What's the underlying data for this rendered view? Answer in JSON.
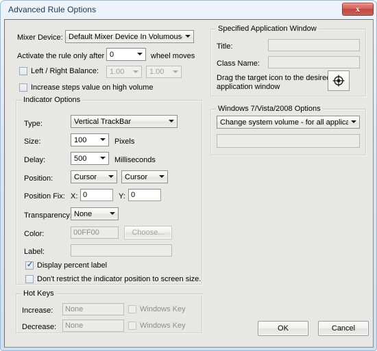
{
  "window": {
    "title": "Advanced Rule Options",
    "close_label": "x",
    "close_icon": "close-icon"
  },
  "mixer": {
    "label": "Mixer Device:",
    "value": "Default Mixer Device In Volumouse"
  },
  "activate": {
    "label": "Activate the rule only after",
    "value": "0",
    "suffix": "wheel moves"
  },
  "balance": {
    "checkbox_label": "Left / Right Balance:",
    "checked": false,
    "left_value": "1.00",
    "right_value": "1.00"
  },
  "increase_steps": {
    "label": "Increase steps value on high volume",
    "checked": false
  },
  "indicator": {
    "group_title": "Indicator Options",
    "type_label": "Type:",
    "type_value": "Vertical TrackBar",
    "size_label": "Size:",
    "size_value": "100",
    "size_units": "Pixels",
    "delay_label": "Delay:",
    "delay_value": "500",
    "delay_units": "Milliseconds",
    "position_label": "Position:",
    "position_x_value": "Cursor",
    "position_y_value": "Cursor",
    "position_fix_label": "Position Fix:",
    "x_label": "X:",
    "x_value": "0",
    "y_label": "Y:",
    "y_value": "0",
    "transparency_label": "Transparency:",
    "transparency_value": "None",
    "color_label": "Color:",
    "color_value": "00FF00",
    "choose_label": "Choose...",
    "text_label": "Label:",
    "text_value": "",
    "display_percent_label": "Display percent label",
    "display_percent_checked": true,
    "no_restrict_label": "Don't restrict the indicator position to screen size.",
    "no_restrict_checked": false
  },
  "hotkeys": {
    "group_title": "Hot Keys",
    "increase_label": "Increase:",
    "increase_value": "None",
    "increase_win_label": "Windows Key",
    "increase_win_checked": false,
    "decrease_label": "Decrease:",
    "decrease_value": "None",
    "decrease_win_label": "Windows Key",
    "decrease_win_checked": false
  },
  "app_window": {
    "group_title": "Specified Application Window",
    "title_label": "Title:",
    "title_value": "",
    "class_label": "Class Name:",
    "class_value": "",
    "drag_line1": "Drag the target icon to the desired",
    "drag_line2": "application window",
    "target_icon": "crosshair-target-icon"
  },
  "win7": {
    "group_title": "Windows 7/Vista/2008 Options",
    "mode_value": "Change system volume - for all applications",
    "extra_value": ""
  },
  "footer": {
    "ok_label": "OK",
    "cancel_label": "Cancel"
  }
}
